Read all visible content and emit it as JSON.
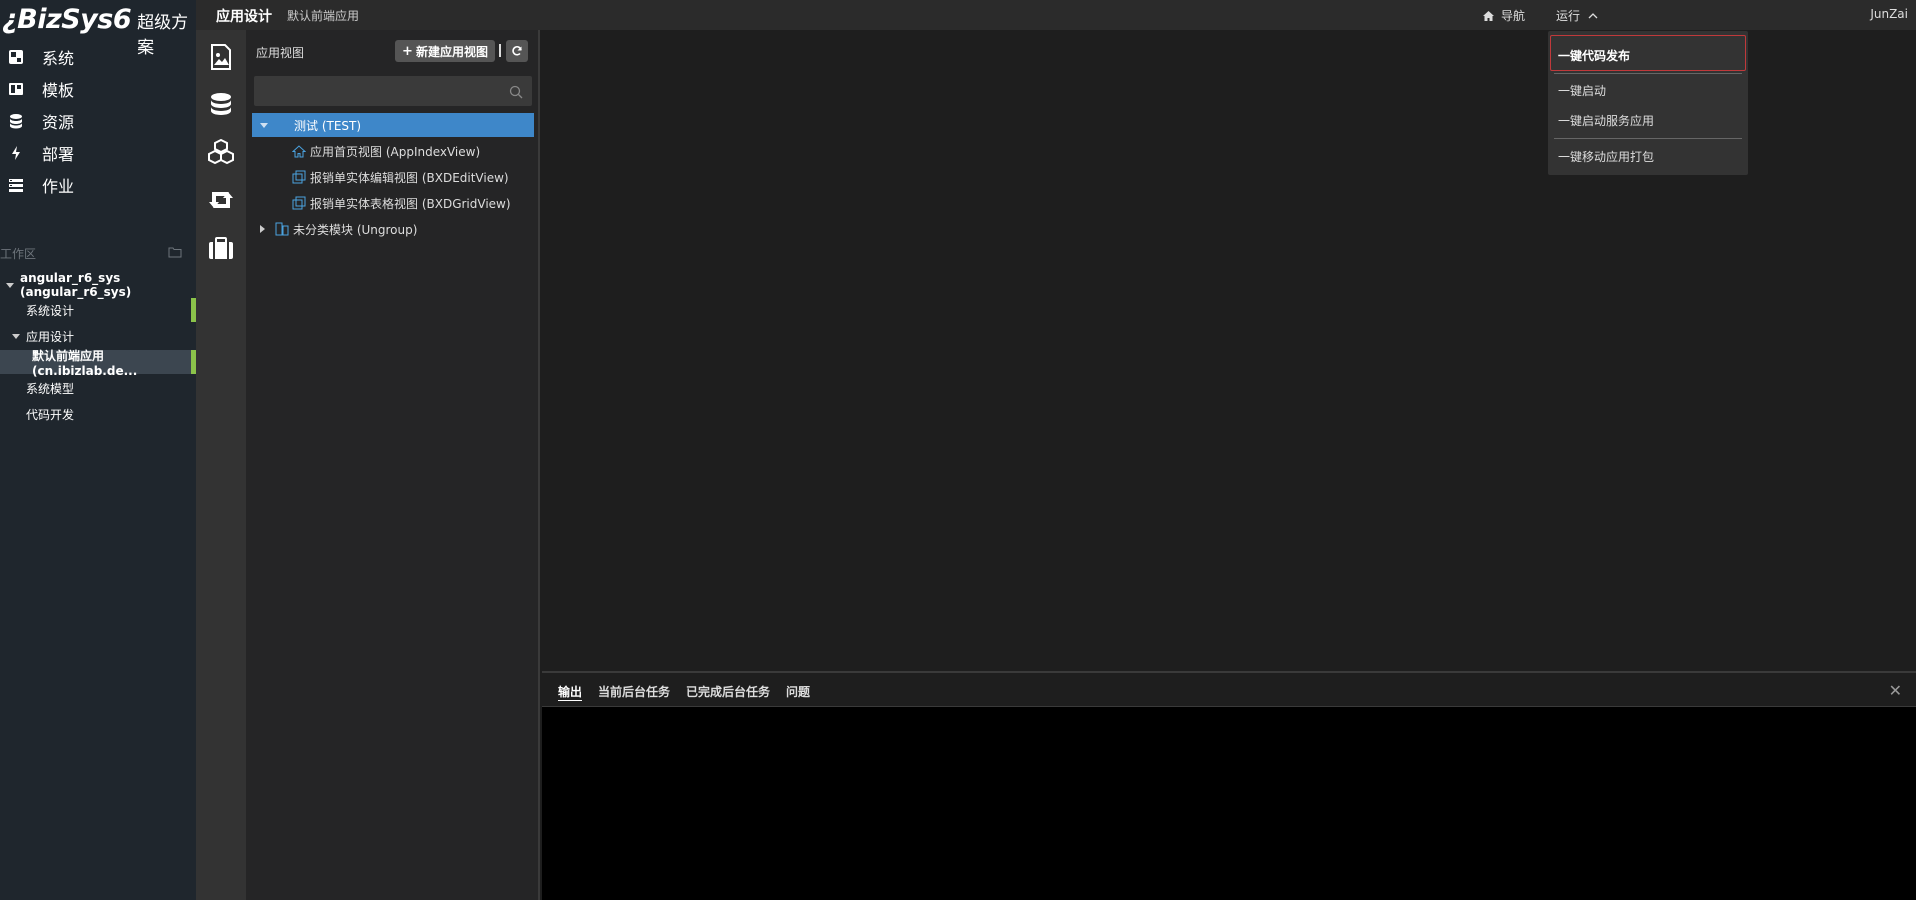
{
  "logo": {
    "brand": "¿BizSys6",
    "subtitle": "超级方案"
  },
  "sidebar": {
    "nav": [
      {
        "label": "系统",
        "icon": "system-icon"
      },
      {
        "label": "模板",
        "icon": "template-icon"
      },
      {
        "label": "资源",
        "icon": "database-icon"
      },
      {
        "label": "部署",
        "icon": "lightning-icon"
      },
      {
        "label": "作业",
        "icon": "tasks-icon"
      }
    ],
    "workspace_label": "工作区",
    "tree": [
      {
        "label": "angular_r6_sys (angular_r6_sys)"
      },
      {
        "label": "系统设计"
      },
      {
        "label": "应用设计"
      },
      {
        "label": "默认前端应用 (cn.ibizlab.de..."
      },
      {
        "label": "系统模型"
      },
      {
        "label": "代码开发"
      }
    ]
  },
  "topbar": {
    "title": "应用设计",
    "subtitle": "默认前端应用",
    "nav_label": "导航",
    "run_label": "运行",
    "user": "JunZai"
  },
  "panel": {
    "title": "应用视图",
    "new_button": "新建应用视图",
    "search_placeholder": "",
    "tree": [
      {
        "label": "测试 (TEST)"
      },
      {
        "label": "应用首页视图 (AppIndexView)"
      },
      {
        "label": "报销单实体编辑视图 (BXDEditView)"
      },
      {
        "label": "报销单实体表格视图 (BXDGridView)"
      },
      {
        "label": "未分类模块 (Ungroup)"
      }
    ]
  },
  "output": {
    "tabs": [
      "输出",
      "当前后台任务",
      "已完成后台任务",
      "问题"
    ],
    "active_tab": 0
  },
  "run_menu": {
    "items": [
      "一键代码发布",
      "一键启动",
      "一键启动服务应用",
      "一键移动应用打包"
    ]
  },
  "colors": {
    "selected_blue": "#3e87c9",
    "active_bar_green": "#8bc34a",
    "highlight_red": "#c0393b"
  }
}
